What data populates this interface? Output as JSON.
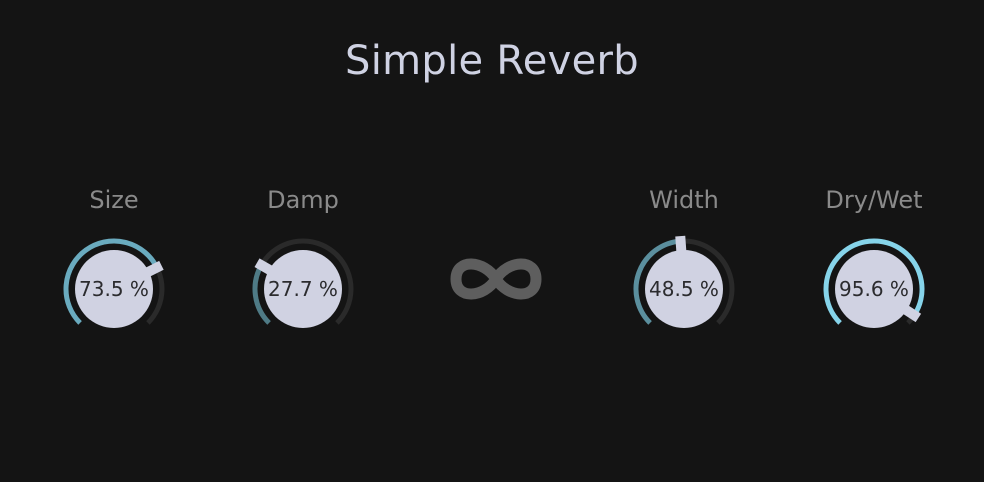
{
  "title": "Simple Reverb",
  "colors": {
    "background": "#141414",
    "title": "#cfd2e3",
    "label": "#8a8a8a",
    "knob_face": "#d0d2e2",
    "track": "#2a2a2a",
    "infinity_icon": "#5e5e5e"
  },
  "knobs": [
    {
      "id": "size",
      "label": "Size",
      "value": 73.5,
      "display": "73.5 %",
      "color": "#6aabbf"
    },
    {
      "id": "damp",
      "label": "Damp",
      "value": 27.7,
      "display": "27.7 %",
      "color": "#4f7b86"
    },
    {
      "id": "width",
      "label": "Width",
      "value": 48.5,
      "display": "48.5 %",
      "color": "#5b8f9e"
    },
    {
      "id": "drywet",
      "label": "Dry/Wet",
      "value": 95.6,
      "display": "95.6 %",
      "color": "#86d4ea"
    }
  ],
  "freeze_button": {
    "icon": "infinity-icon"
  }
}
